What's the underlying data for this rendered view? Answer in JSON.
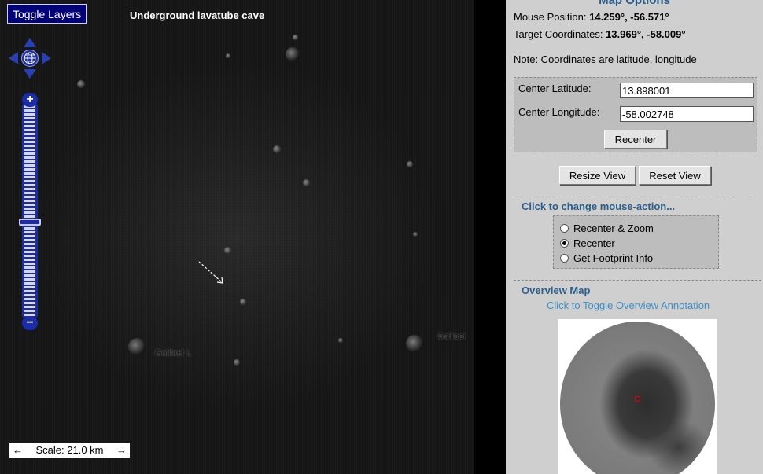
{
  "map": {
    "toggle_layers_label": "Toggle Layers",
    "title": "Underground lavatube cave",
    "crater_labels": [
      "Galilaei L",
      "Galilaei"
    ],
    "scale_left": "←",
    "scale_text": "Scale: 21.0 km",
    "scale_right": "→",
    "zoom_in_label": "+",
    "zoom_out_label": "−"
  },
  "panel": {
    "title": "Map Options",
    "mouse_position_label": "Mouse Position: ",
    "mouse_position_value": "14.259°, -56.571°",
    "target_coords_label": "Target Coordinates: ",
    "target_coords_value": "13.969°, -58.009°",
    "note": "Note: Coordinates are latitude, longitude",
    "center_latitude_label": "Center Latitude:",
    "center_latitude_value": "13.898001",
    "center_longitude_label": "Center Longitude:",
    "center_longitude_value": "-58.002748",
    "recenter_button": "Recenter",
    "resize_view_button": "Resize View",
    "reset_view_button": "Reset View",
    "mouse_action_heading": "Click to change mouse-action...",
    "mouse_actions": [
      {
        "label": "Recenter & Zoom",
        "selected": false
      },
      {
        "label": "Recenter",
        "selected": true
      },
      {
        "label": "Get Footprint Info",
        "selected": false
      }
    ],
    "overview_heading": "Overview Map",
    "overview_toggle_link": "Click to Toggle Overview Annotation"
  },
  "colors": {
    "panel_bg": "#cfcfcf",
    "heading_blue": "#2a5d8c",
    "link_blue": "#3b8fc8",
    "control_blue": "#1a2ca8",
    "marker_red": "#e00000"
  },
  "icons": [
    "pan-up-icon",
    "pan-down-icon",
    "pan-left-icon",
    "pan-right-icon",
    "globe-home-icon",
    "zoom-in-icon",
    "zoom-out-icon",
    "zoom-slider-handle"
  ]
}
